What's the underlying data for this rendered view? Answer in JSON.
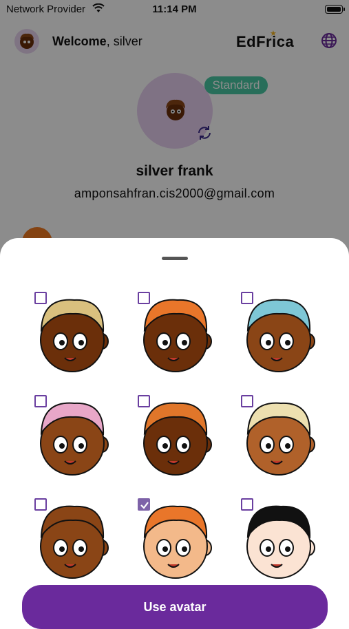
{
  "status_bar": {
    "carrier": "Network Provider",
    "time": "11:14 PM"
  },
  "header": {
    "welcome_label": "Welcome",
    "user_first_name": ", silver",
    "logo_text": "EdFrica",
    "language_icon": "globe-icon"
  },
  "profile": {
    "badge": "Standard",
    "full_name": "silver frank",
    "email": "amponsahfran.cis2000@gmail.com"
  },
  "avatar_picker": {
    "avatars": [
      {
        "id": "avatar-1",
        "selected": false,
        "skin": "#6b2f0a",
        "hair": "#d9c07e"
      },
      {
        "id": "avatar-2",
        "selected": false,
        "skin": "#6b2f0a",
        "hair": "#e9762a"
      },
      {
        "id": "avatar-3",
        "selected": false,
        "skin": "#8a4516",
        "hair": "#7ec7d6"
      },
      {
        "id": "avatar-4",
        "selected": false,
        "skin": "#8a4516",
        "hair": "#e8a7c8"
      },
      {
        "id": "avatar-5",
        "selected": false,
        "skin": "#6b2f0a",
        "hair": "#e0762a"
      },
      {
        "id": "avatar-6",
        "selected": false,
        "skin": "#b0612a",
        "hair": "#ede0b0"
      },
      {
        "id": "avatar-7",
        "selected": false,
        "skin": "#8a4516",
        "hair": "#8a4516"
      },
      {
        "id": "avatar-8",
        "selected": true,
        "skin": "#f3b98a",
        "hair": "#e9762a"
      },
      {
        "id": "avatar-9",
        "selected": false,
        "skin": "#fbe3d3",
        "hair": "#111111"
      }
    ],
    "use_button_label": "Use avatar"
  },
  "colors": {
    "accent": "#6a2a9c",
    "badge": "#49c9a4",
    "checkbox": "#6a3fa0"
  }
}
